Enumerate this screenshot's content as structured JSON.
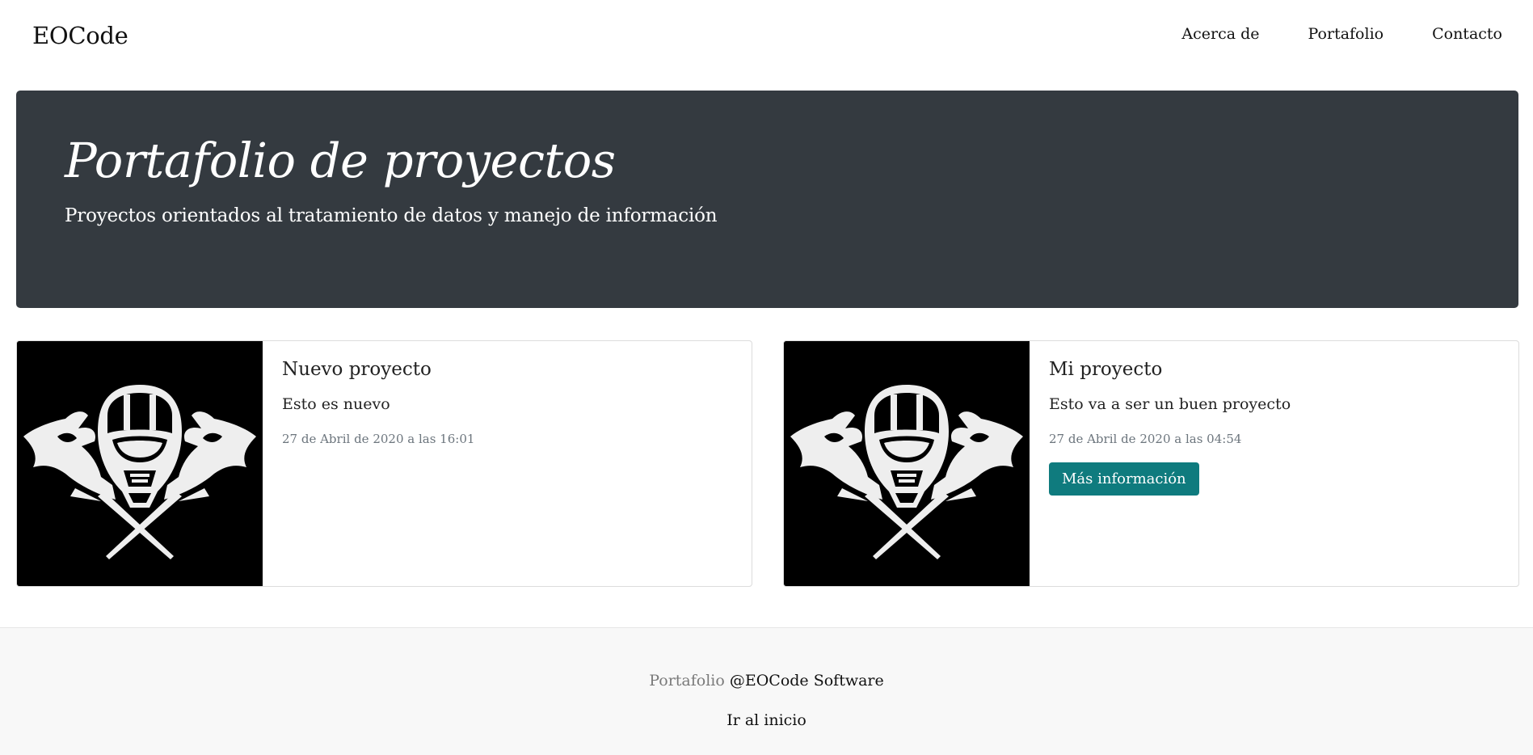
{
  "navbar": {
    "brand": "EOCode",
    "links": [
      "Acerca de",
      "Portafolio",
      "Contacto"
    ]
  },
  "hero": {
    "title": "Portafolio de proyectos",
    "lead": "Proyectos orientados al tratamiento de datos y manejo de información",
    "background_color": "#343a40"
  },
  "projects": [
    {
      "image_icon": "crossed-energy-swords-helmet-emblem",
      "title": "Nuevo proyecto",
      "description": "Esto es nuevo",
      "date": "27 de Abril de 2020 a las 16:01"
    },
    {
      "image_icon": "crossed-energy-swords-helmet-emblem",
      "title": "Mi proyecto",
      "description": "Esto va a ser un buen proyecto",
      "date": "27 de Abril de 2020 a las 04:54",
      "button_label": "Más información",
      "button_color": "#0f7b7e"
    }
  ],
  "footer": {
    "muted_text": "Portafolio",
    "owner_text": "@EOCode Software",
    "home_link": "Ir al inicio"
  }
}
